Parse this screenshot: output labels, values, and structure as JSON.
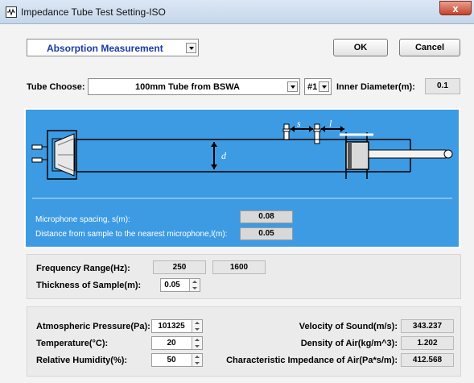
{
  "window": {
    "title": "Impedance Tube Test Setting-ISO",
    "close_label": "x"
  },
  "header": {
    "measurement_select": "Absorption Measurement",
    "ok_label": "OK",
    "cancel_label": "Cancel"
  },
  "tube": {
    "label": "Tube Choose:",
    "selected": "100mm Tube from BSWA",
    "number": "#1",
    "inner_diameter_label": "Inner Diameter(m):",
    "inner_diameter_value": "0.1"
  },
  "diagram": {
    "s_label": "s",
    "l_label": "l",
    "d_label": "d",
    "mic_spacing_label": "Microphone spacing, s(m):",
    "mic_spacing_value": "0.08",
    "distance_label": "Distance from sample to the nearest microphone,l(m):",
    "distance_value": "0.05"
  },
  "frequency": {
    "label": "Frequency Range(Hz):",
    "low": "250",
    "high": "1600",
    "thickness_label": "Thickness of Sample(m):",
    "thickness_value": "0.05"
  },
  "environment": {
    "pressure_label": "Atmospheric Pressure(Pa):",
    "pressure_value": "101325",
    "temperature_label": "Temperature(°C):",
    "temperature_value": "20",
    "humidity_label": "Relative Humidity(%):",
    "humidity_value": "50",
    "velocity_label": "Velocity of Sound(m/s):",
    "velocity_value": "343.237",
    "density_label": "Density of Air(kg/m^3):",
    "density_value": "1.202",
    "impedance_label": "Characteristic Impedance of Air(Pa*s/m):",
    "impedance_value": "412.568"
  },
  "colors": {
    "diagram_bg": "#3d9be3",
    "measurement_text": "#1a3aa8"
  }
}
